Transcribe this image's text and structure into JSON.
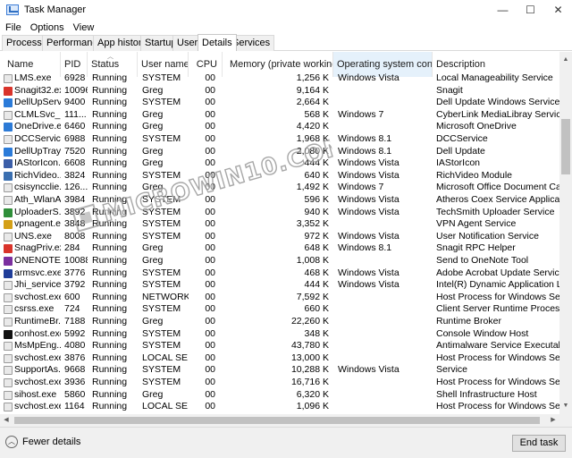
{
  "window": {
    "title": "Task Manager",
    "minimize": "—",
    "maximize": "☐",
    "close": "✕"
  },
  "menu": [
    "File",
    "Options",
    "View"
  ],
  "tabs": [
    "Processes",
    "Performance",
    "App history",
    "Startup",
    "Users",
    "Details",
    "Services"
  ],
  "active_tab": "Details",
  "columns": [
    "Name",
    "PID",
    "Status",
    "User name",
    "CPU",
    "Memory (private working set)",
    "Operating system context",
    "Description"
  ],
  "rows": [
    {
      "icon": "orange-service-icon",
      "color": "#e9e9e9",
      "name": "LMS.exe",
      "pid": "6928",
      "status": "Running",
      "user": "SYSTEM",
      "cpu": "00",
      "mem": "1,256 K",
      "os": "Windows Vista",
      "desc": "Local Manageability Service"
    },
    {
      "icon": "snagit-icon",
      "color": "#d9342b",
      "name": "Snagit32.exe",
      "pid": "10096",
      "status": "Running",
      "user": "Greg",
      "cpu": "00",
      "mem": "9,164 K",
      "os": "",
      "desc": "Snagit"
    },
    {
      "icon": "dell-icon",
      "color": "#2b7bd9",
      "name": "DellUpServ...",
      "pid": "9400",
      "status": "Running",
      "user": "SYSTEM",
      "cpu": "00",
      "mem": "2,664 K",
      "os": "",
      "desc": "Dell Update Windows Service"
    },
    {
      "icon": "service-icon",
      "color": "#e9e9e9",
      "name": "CLMLSvc_...",
      "pid": "111...",
      "status": "Running",
      "user": "Greg",
      "cpu": "00",
      "mem": "568 K",
      "os": "Windows 7",
      "desc": "CyberLink MediaLibray Service"
    },
    {
      "icon": "onedrive-icon",
      "color": "#2c7ad6",
      "name": "OneDrive.e...",
      "pid": "6460",
      "status": "Running",
      "user": "Greg",
      "cpu": "00",
      "mem": "4,420 K",
      "os": "",
      "desc": "Microsoft OneDrive"
    },
    {
      "icon": "service-icon",
      "color": "#e9e9e9",
      "name": "DCCServic...",
      "pid": "6988",
      "status": "Running",
      "user": "SYSTEM",
      "cpu": "00",
      "mem": "1,968 K",
      "os": "Windows 8.1",
      "desc": "DCCService"
    },
    {
      "icon": "dell-icon",
      "color": "#2b7bd9",
      "name": "DellUpTray...",
      "pid": "7520",
      "status": "Running",
      "user": "Greg",
      "cpu": "00",
      "mem": "2,080 K",
      "os": "Windows 8.1",
      "desc": "Dell Update"
    },
    {
      "icon": "gear-icon",
      "color": "#3b5ea8",
      "name": "IAStorIcon...",
      "pid": "6608",
      "status": "Running",
      "user": "Greg",
      "cpu": "00",
      "mem": "444 K",
      "os": "Windows Vista",
      "desc": "IAStorIcon"
    },
    {
      "icon": "video-icon",
      "color": "#3b6fb0",
      "name": "RichVideo....",
      "pid": "3824",
      "status": "Running",
      "user": "SYSTEM",
      "cpu": "00",
      "mem": "640 K",
      "os": "Windows Vista",
      "desc": "RichVideo Module"
    },
    {
      "icon": "service-icon",
      "color": "#e9e9e9",
      "name": "csisyncclie...",
      "pid": "126...",
      "status": "Running",
      "user": "Greg",
      "cpu": "00",
      "mem": "1,492 K",
      "os": "Windows 7",
      "desc": "Microsoft Office Document Cache Sy"
    },
    {
      "icon": "service-icon",
      "color": "#e9e9e9",
      "name": "Ath_WlanA...",
      "pid": "3984",
      "status": "Running",
      "user": "SYSTEM",
      "cpu": "00",
      "mem": "596 K",
      "os": "Windows Vista",
      "desc": "Atheros Coex Service Application"
    },
    {
      "icon": "uploader-icon",
      "color": "#2f8f3a",
      "name": "UploaderS...",
      "pid": "3892",
      "status": "Running",
      "user": "SYSTEM",
      "cpu": "00",
      "mem": "940 K",
      "os": "Windows Vista",
      "desc": "TechSmith Uploader Service"
    },
    {
      "icon": "vpn-lock-icon",
      "color": "#d4a017",
      "name": "vpnagent.e...",
      "pid": "3848",
      "status": "Running",
      "user": "SYSTEM",
      "cpu": "00",
      "mem": "3,352 K",
      "os": "",
      "desc": "VPN Agent Service"
    },
    {
      "icon": "service-icon",
      "color": "#e9e9e9",
      "name": "UNS.exe",
      "pid": "8008",
      "status": "Running",
      "user": "SYSTEM",
      "cpu": "00",
      "mem": "972 K",
      "os": "Windows Vista",
      "desc": "User Notification Service"
    },
    {
      "icon": "snagit-icon",
      "color": "#d9342b",
      "name": "SnagPriv.exe",
      "pid": "284",
      "status": "Running",
      "user": "Greg",
      "cpu": "00",
      "mem": "648 K",
      "os": "Windows 8.1",
      "desc": "Snagit RPC Helper"
    },
    {
      "icon": "onenote-icon",
      "color": "#7b2f9f",
      "name": "ONENOTE...",
      "pid": "10088",
      "status": "Running",
      "user": "Greg",
      "cpu": "00",
      "mem": "1,008 K",
      "os": "",
      "desc": "Send to OneNote Tool"
    },
    {
      "icon": "window-icon",
      "color": "#1f3d99",
      "name": "armsvc.exe",
      "pid": "3776",
      "status": "Running",
      "user": "SYSTEM",
      "cpu": "00",
      "mem": "468 K",
      "os": "Windows Vista",
      "desc": "Adobe Acrobat Update Service"
    },
    {
      "icon": "service-icon",
      "color": "#e9e9e9",
      "name": "Jhi_service....",
      "pid": "3792",
      "status": "Running",
      "user": "SYSTEM",
      "cpu": "00",
      "mem": "444 K",
      "os": "Windows Vista",
      "desc": "Intel(R) Dynamic Application Loader"
    },
    {
      "icon": "service-icon",
      "color": "#e9e9e9",
      "name": "svchost.exe",
      "pid": "600",
      "status": "Running",
      "user": "NETWORK...",
      "cpu": "00",
      "mem": "7,592 K",
      "os": "",
      "desc": "Host Process for Windows Services"
    },
    {
      "icon": "service-icon",
      "color": "#e9e9e9",
      "name": "csrss.exe",
      "pid": "724",
      "status": "Running",
      "user": "SYSTEM",
      "cpu": "00",
      "mem": "660 K",
      "os": "",
      "desc": "Client Server Runtime Process"
    },
    {
      "icon": "service-icon",
      "color": "#e9e9e9",
      "name": "RuntimeBr...",
      "pid": "7188",
      "status": "Running",
      "user": "Greg",
      "cpu": "00",
      "mem": "22,260 K",
      "os": "",
      "desc": "Runtime Broker"
    },
    {
      "icon": "console-icon",
      "color": "#111111",
      "name": "conhost.exe",
      "pid": "5992",
      "status": "Running",
      "user": "SYSTEM",
      "cpu": "00",
      "mem": "348 K",
      "os": "",
      "desc": "Console Window Host"
    },
    {
      "icon": "service-icon",
      "color": "#e9e9e9",
      "name": "MsMpEng....",
      "pid": "4080",
      "status": "Running",
      "user": "SYSTEM",
      "cpu": "00",
      "mem": "43,780 K",
      "os": "",
      "desc": "Antimalware Service Executable"
    },
    {
      "icon": "service-icon",
      "color": "#e9e9e9",
      "name": "svchost.exe",
      "pid": "3876",
      "status": "Running",
      "user": "LOCAL SE...",
      "cpu": "00",
      "mem": "13,000 K",
      "os": "",
      "desc": "Host Process for Windows Services"
    },
    {
      "icon": "service-icon",
      "color": "#e9e9e9",
      "name": "SupportAs...",
      "pid": "9668",
      "status": "Running",
      "user": "SYSTEM",
      "cpu": "00",
      "mem": "10,288 K",
      "os": "Windows Vista",
      "desc": "Service"
    },
    {
      "icon": "service-icon",
      "color": "#e9e9e9",
      "name": "svchost.exe",
      "pid": "3936",
      "status": "Running",
      "user": "SYSTEM",
      "cpu": "00",
      "mem": "16,716 K",
      "os": "",
      "desc": "Host Process for Windows Services"
    },
    {
      "icon": "service-icon",
      "color": "#e9e9e9",
      "name": "sihost.exe",
      "pid": "5860",
      "status": "Running",
      "user": "Greg",
      "cpu": "00",
      "mem": "6,320 K",
      "os": "",
      "desc": "Shell Infrastructure Host"
    },
    {
      "icon": "service-icon",
      "color": "#e9e9e9",
      "name": "svchost.exe",
      "pid": "1164",
      "status": "Running",
      "user": "LOCAL SE...",
      "cpu": "00",
      "mem": "1,096 K",
      "os": "",
      "desc": "Host Process for Windows Services"
    }
  ],
  "footer": {
    "fewer_details": "Fewer details",
    "end_task": "End task"
  },
  "watermark": "MICROWIN10.COM"
}
